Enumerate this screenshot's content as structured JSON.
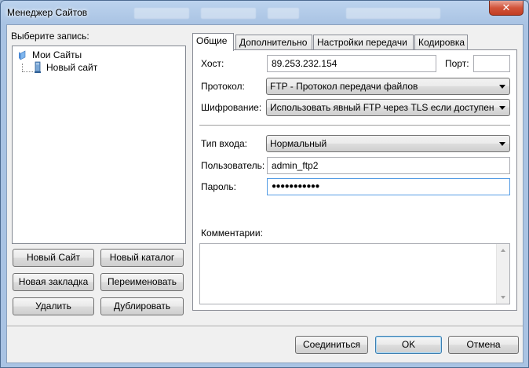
{
  "window": {
    "title": "Менеджер Сайтов",
    "close_glyph": "✕"
  },
  "left": {
    "select_label": "Выберите запись:",
    "tree": [
      {
        "label": "Мои Сайты",
        "icon": "folder-icon"
      },
      {
        "label": "Новый сайт",
        "icon": "server-icon"
      }
    ],
    "buttons": {
      "new_site": "Новый Сайт",
      "new_folder": "Новый каталог",
      "new_bookmark": "Новая закладка",
      "rename": "Переименовать",
      "delete": "Удалить",
      "duplicate": "Дублировать"
    }
  },
  "tabs": [
    "Общие",
    "Дополнительно",
    "Настройки передачи",
    "Кодировка"
  ],
  "general": {
    "host_label": "Хост:",
    "host_value": "89.253.232.154",
    "port_label": "Порт:",
    "port_value": "",
    "protocol_label": "Протокол:",
    "protocol_value": "FTP - Протокол передачи файлов",
    "encryption_label": "Шифрование:",
    "encryption_value": "Использовать явный FTP через TLS если доступен",
    "logon_label": "Тип входа:",
    "logon_value": "Нормальный",
    "user_label": "Пользователь:",
    "user_value": "admin_ftp2",
    "password_label": "Пароль:",
    "password_value": "●●●●●●●●●●●",
    "comments_label": "Комментарии:",
    "comments_value": ""
  },
  "footer": {
    "connect": "Соединиться",
    "ok": "OK",
    "cancel": "Отмена"
  }
}
